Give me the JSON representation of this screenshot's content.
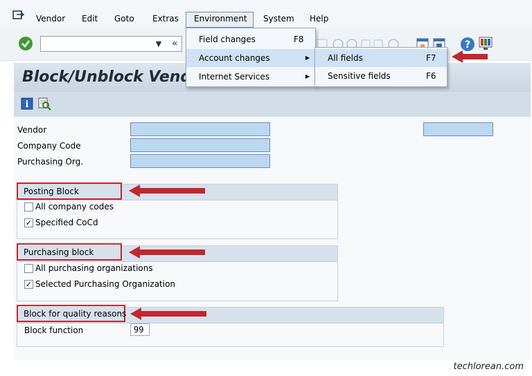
{
  "menubar": {
    "items": [
      {
        "label": "Vendor"
      },
      {
        "label": "Edit"
      },
      {
        "label": "Goto"
      },
      {
        "label": "Extras"
      },
      {
        "label": "Environment"
      },
      {
        "label": "System"
      },
      {
        "label": "Help"
      }
    ]
  },
  "toolbar": {
    "back_glyph": "«"
  },
  "title": {
    "text": "Block/Unblock Vendor:"
  },
  "form": {
    "vendor_label": "Vendor",
    "company_code_label": "Company Code",
    "purchasing_org_label": "Purchasing Org."
  },
  "posting_block": {
    "title": "Posting Block",
    "all_company_codes": "All company codes",
    "all_company_codes_checked": false,
    "specified_cocd": "Specified CoCd",
    "specified_cocd_checked": true
  },
  "purchasing_block": {
    "title": "Purchasing block",
    "all_purchasing_orgs": "All purchasing organizations",
    "all_purchasing_orgs_checked": false,
    "selected_purchasing_org": "Selected Purchasing Organization",
    "selected_purchasing_org_checked": true
  },
  "quality_block": {
    "title": "Block for quality reasons",
    "block_function_label": "Block function",
    "block_function_value": "99"
  },
  "environment_menu": {
    "field_changes": "Field changes",
    "field_changes_key": "F8",
    "account_changes": "Account changes",
    "internet_services": "Internet Services"
  },
  "account_changes_menu": {
    "all_fields": "All fields",
    "all_fields_key": "F7",
    "sensitive_fields": "Sensitive fields",
    "sensitive_fields_key": "F6"
  },
  "watermark": "techlorean.com",
  "colors": {
    "annotation_red": "#c1272d",
    "field_blue": "#bcd8f1",
    "highlight": "#cfe2f5"
  }
}
